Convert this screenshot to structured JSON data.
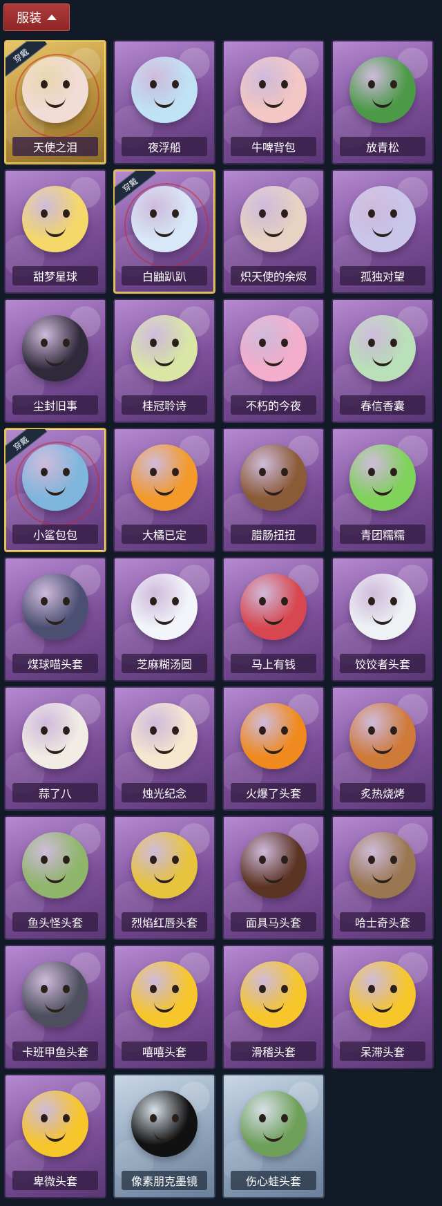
{
  "header": {
    "label": "服装"
  },
  "worn_label": "穿戴",
  "items": [
    {
      "name": "天使之泪",
      "worn": true,
      "bg": "gold",
      "color": "#f2dcd6",
      "icon": "angel-halo-icon"
    },
    {
      "name": "夜浮船",
      "worn": false,
      "bg": "purple",
      "color": "#bfe2f5",
      "icon": "jellyfish-icon"
    },
    {
      "name": "牛啤背包",
      "worn": false,
      "bg": "purple",
      "color": "#f3c7c4",
      "icon": "cow-barrel-icon"
    },
    {
      "name": "放青松",
      "worn": false,
      "bg": "purple",
      "color": "#4c9a48",
      "icon": "bonsai-icon"
    },
    {
      "name": "甜梦星球",
      "worn": false,
      "bg": "purple",
      "color": "#f5d86a",
      "icon": "moon-fox-icon"
    },
    {
      "name": "白鼬趴趴",
      "worn": true,
      "bg": "purple",
      "color": "#d8e8f8",
      "icon": "white-ferret-icon"
    },
    {
      "name": "炽天使的余烬",
      "worn": false,
      "bg": "purple",
      "color": "#e7d2c3",
      "icon": "angel-doll-icon"
    },
    {
      "name": "孤独对望",
      "worn": false,
      "bg": "purple",
      "color": "#c9c6ea",
      "icon": "doll-charm-icon"
    },
    {
      "name": "尘封旧事",
      "worn": false,
      "bg": "purple",
      "color": "#2f2a3a",
      "icon": "prince-doll-icon"
    },
    {
      "name": "桂冠聆诗",
      "worn": false,
      "bg": "purple",
      "color": "#d9e6a6",
      "icon": "laurel-doll-icon"
    },
    {
      "name": "不朽的今夜",
      "worn": false,
      "bg": "purple",
      "color": "#f4aecb",
      "icon": "pink-cat-icon"
    },
    {
      "name": "春信香囊",
      "worn": false,
      "bg": "purple",
      "color": "#b9e0b8",
      "icon": "sachet-icon"
    },
    {
      "name": "小鲨包包",
      "worn": true,
      "bg": "purple",
      "color": "#7fb6dd",
      "icon": "shark-bag-icon"
    },
    {
      "name": "大橘已定",
      "worn": false,
      "bg": "purple",
      "color": "#f39a2a",
      "icon": "orange-slice-icon"
    },
    {
      "name": "腊肠扭扭",
      "worn": false,
      "bg": "purple",
      "color": "#8b5a36",
      "icon": "dachshund-icon"
    },
    {
      "name": "青团糯糯",
      "worn": false,
      "bg": "purple",
      "color": "#7fd25a",
      "icon": "green-dumpling-icon"
    },
    {
      "name": "煤球喵头套",
      "worn": false,
      "bg": "purple",
      "color": "#4b4f72",
      "icon": "black-cat-mask-icon"
    },
    {
      "name": "芝麻糊汤圆",
      "worn": false,
      "bg": "purple",
      "color": "#f2f5fa",
      "icon": "rice-ball-icon"
    },
    {
      "name": "马上有钱",
      "worn": false,
      "bg": "purple",
      "color": "#d8474f",
      "icon": "red-horse-icon"
    },
    {
      "name": "饺饺者头套",
      "worn": false,
      "bg": "purple",
      "color": "#eef2f5",
      "icon": "cloud-mask-icon"
    },
    {
      "name": "蒜了八",
      "worn": false,
      "bg": "purple",
      "color": "#f1ece4",
      "icon": "garlic-icon"
    },
    {
      "name": "烛光纪念",
      "worn": false,
      "bg": "purple",
      "color": "#f7e7cf",
      "icon": "candle-icon"
    },
    {
      "name": "火爆了头套",
      "worn": false,
      "bg": "purple",
      "color": "#f08a1e",
      "icon": "fire-mask-icon"
    },
    {
      "name": "炙热烧烤",
      "worn": false,
      "bg": "purple",
      "color": "#d07a3a",
      "icon": "bbq-meat-icon"
    },
    {
      "name": "鱼头怪头套",
      "worn": false,
      "bg": "purple",
      "color": "#8fb66a",
      "icon": "fish-mask-icon"
    },
    {
      "name": "烈焰红唇头套",
      "worn": false,
      "bg": "purple",
      "color": "#e8c43c",
      "icon": "yellow-mask-icon"
    },
    {
      "name": "面具马头套",
      "worn": false,
      "bg": "purple",
      "color": "#5c3424",
      "icon": "horse-mask-icon"
    },
    {
      "name": "哈士奇头套",
      "worn": false,
      "bg": "purple",
      "color": "#9a7750",
      "icon": "husky-mask-icon"
    },
    {
      "name": "卡班甲鱼头套",
      "worn": false,
      "bg": "purple",
      "color": "#4d4f5e",
      "icon": "fish-head-icon"
    },
    {
      "name": "嘻嘻头套",
      "worn": false,
      "bg": "purple",
      "color": "#f7c62a",
      "icon": "grin-emoji-icon"
    },
    {
      "name": "滑稽头套",
      "worn": false,
      "bg": "purple",
      "color": "#f7c62a",
      "icon": "smirk-emoji-icon"
    },
    {
      "name": "呆滞头套",
      "worn": false,
      "bg": "purple",
      "color": "#f7c62a",
      "icon": "stare-emoji-icon"
    },
    {
      "name": "卑微头套",
      "worn": false,
      "bg": "purple",
      "color": "#f7c62a",
      "icon": "humble-emoji-icon"
    },
    {
      "name": "像素朋克墨镜",
      "worn": false,
      "bg": "light",
      "color": "#111111",
      "icon": "pixel-sunglasses-icon"
    },
    {
      "name": "伤心蛙头套",
      "worn": false,
      "bg": "light",
      "color": "#6fa05a",
      "icon": "sad-frog-icon"
    }
  ]
}
